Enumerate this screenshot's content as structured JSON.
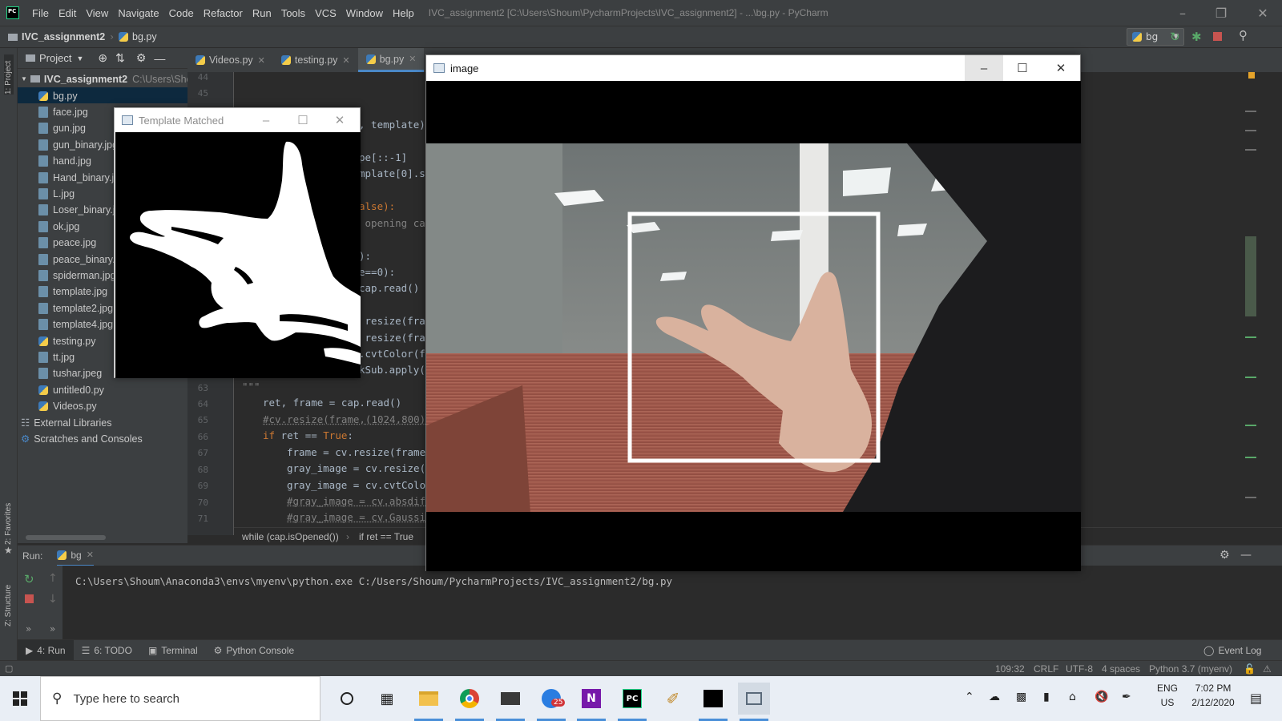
{
  "app": {
    "title": "IVC_assignment2 [C:\\Users\\Shoum\\PycharmProjects\\IVC_assignment2] - ...\\bg.py - PyCharm",
    "menu": [
      "File",
      "Edit",
      "View",
      "Navigate",
      "Code",
      "Refactor",
      "Run",
      "Tools",
      "VCS",
      "Window",
      "Help"
    ]
  },
  "navbar": {
    "project": "IVC_assignment2",
    "file": "bg.py",
    "run_config": "bg"
  },
  "left_stripe": {
    "project_label": "1: Project",
    "favorites_label": "2: Favorites",
    "structure_label": "Z: Structure"
  },
  "project_panel": {
    "header": "Project",
    "root": {
      "name": "IVC_assignment2",
      "path": "C:\\Users\\Shoum"
    },
    "files": [
      {
        "name": "bg.py",
        "type": "py"
      },
      {
        "name": "face.jpg",
        "type": "jpg"
      },
      {
        "name": "gun.jpg",
        "type": "jpg"
      },
      {
        "name": "gun_binary.jpg",
        "type": "jpg"
      },
      {
        "name": "hand.jpg",
        "type": "jpg"
      },
      {
        "name": "Hand_binary.jpg",
        "type": "jpg"
      },
      {
        "name": "L.jpg",
        "type": "jpg"
      },
      {
        "name": "Loser_binary.jpg",
        "type": "jpg"
      },
      {
        "name": "ok.jpg",
        "type": "jpg"
      },
      {
        "name": "peace.jpg",
        "type": "jpg"
      },
      {
        "name": "peace_binary.jpg",
        "type": "jpg"
      },
      {
        "name": "spiderman.jpg",
        "type": "jpg"
      },
      {
        "name": "template.jpg",
        "type": "jpg"
      },
      {
        "name": "template2.jpg",
        "type": "jpg"
      },
      {
        "name": "template4.jpg",
        "type": "jpg"
      },
      {
        "name": "testing.py",
        "type": "py"
      },
      {
        "name": "tt.jpg",
        "type": "jpg"
      },
      {
        "name": "tushar.jpeg",
        "type": "jpg"
      },
      {
        "name": "untitled0.py",
        "type": "py"
      },
      {
        "name": "Videos.py",
        "type": "py"
      }
    ],
    "external": "External Libraries",
    "scratches": "Scratches and Consoles"
  },
  "editor": {
    "tabs": [
      {
        "label": "Videos.py",
        "active": false
      },
      {
        "label": "testing.py",
        "active": false
      },
      {
        "label": "bg.py",
        "active": true
      }
    ],
    "line_numbers": [
      "44",
      "45",
      "63",
      "64",
      "65",
      "66",
      "67",
      "68",
      "69",
      "70",
      "71"
    ],
    "partial_code": {
      "l1": ", template)",
      "l2": "pe[::-1]",
      "l3": "mplate[0].sh",
      "l4": "alse):",
      "l5": " opening cam",
      "l6": "):",
      "l7": "e==0):",
      "l8": "cap.read()",
      "l9": " resize(fram",
      "l10": " resize(fram",
      "l11": ".cvtColor(fr",
      "l12": "kSub.apply(f"
    },
    "code": {
      "l63": "\"\"\"",
      "l64a": "ret, frame = cap.read()",
      "l65": "#cv.resize(frame,(1024,800))",
      "l66a": "if",
      "l66b": " ret == ",
      "l66c": "True",
      "l66d": ":",
      "l67": "frame = cv.resize(frame,",
      "l68": "gray_image = cv.resize(f",
      "l69": "gray_image = cv.cvtColor",
      "l70": "#gray_image = cv.absdiff",
      "l71": "#gray_image = cv.Gaussia"
    },
    "breadcrumbs": [
      "while (cap.isOpened())",
      "if ret == True"
    ]
  },
  "run_panel": {
    "label": "Run:",
    "tab": "bg",
    "command": "C:\\Users\\Shoum\\Anaconda3\\envs\\myenv\\python.exe C:/Users/Shoum/PycharmProjects/IVC_assignment2/bg.py"
  },
  "bottom_tools": [
    "4: Run",
    "6: TODO",
    "Terminal",
    "Python Console"
  ],
  "event_log": "Event Log",
  "status_bar": {
    "position": "109:32",
    "line_sep": "CRLF",
    "encoding": "UTF-8",
    "indent": "4 spaces",
    "interpreter": "Python 3.7 (myenv)"
  },
  "template_window": {
    "title": "Template Matched"
  },
  "image_window": {
    "title": "image"
  },
  "taskbar": {
    "search_placeholder": "Type here to search",
    "badge_count": "25",
    "lang1": "ENG",
    "lang2": "US",
    "time": "7:02 PM",
    "date": "2/12/2020"
  }
}
